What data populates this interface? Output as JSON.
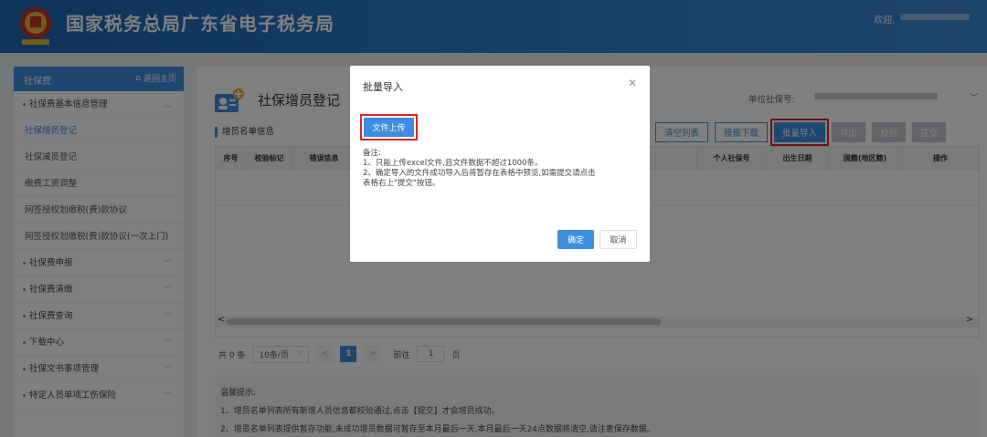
{
  "header": {
    "site_title": "国家税务总局广东省电子税务局",
    "welcome": "欢迎,"
  },
  "sidebar": {
    "title": "社保费",
    "home_link": "返回主页",
    "items": [
      {
        "label": "社保费基本信息管理",
        "type": "group"
      },
      {
        "label": "社保增员登记",
        "type": "sub",
        "active": true
      },
      {
        "label": "社保减员登记",
        "type": "sub"
      },
      {
        "label": "缴费工资调整",
        "type": "sub"
      },
      {
        "label": "网签授权划缴税(费)款协议",
        "type": "sub"
      },
      {
        "label": "网签授权划缴税(费)款协议(一次上门)",
        "type": "sub"
      },
      {
        "label": "社保费申报",
        "type": "group"
      },
      {
        "label": "社保费清缴",
        "type": "group"
      },
      {
        "label": "社保费查询",
        "type": "group"
      },
      {
        "label": "下载中心",
        "type": "group"
      },
      {
        "label": "社保文书事项管理",
        "type": "group"
      },
      {
        "label": "特定人员单项工伤保险",
        "type": "group"
      }
    ]
  },
  "main": {
    "page_title": "社保增员登记",
    "unit_label": "单位社保号:",
    "section_title": "增员名单信息",
    "buttons": {
      "clear": "清空列表",
      "template": "模板下载",
      "batch_import": "批量导入",
      "export": "导出",
      "verify": "校验",
      "submit": "提交"
    },
    "table": {
      "columns": [
        "序号",
        "校验标记",
        "错误信息",
        "个人社保号",
        "出生日期",
        "国籍(地区籍)",
        "操作"
      ]
    },
    "pager": {
      "total": "共 0 条",
      "page_size": "10条/页",
      "current_page": "1",
      "goto_label": "前往",
      "goto_value": "1",
      "page_unit": "页"
    },
    "tips": {
      "title": "温馨提示:",
      "lines": [
        "1、增员名单列表所有新增人员信息都校验通过,点击【提交】才会增员成功。",
        "2、增员名单列表提供暂存功能,未成功增员数据可暂存至本月最后一天,本月最后一天24点数据将清空,请注意保存数据。"
      ]
    }
  },
  "modal": {
    "title": "批量导入",
    "upload_button": "文件上传",
    "note_title": "备注:",
    "note_lines": [
      "1、只能上传excel文件,且文件数据不超过1000条。",
      "2、确定导入的文件成功导入后将暂存在表格中预览,如需提交请点击",
      "表格右上\"提交\"按钮。"
    ],
    "ok": "确定",
    "cancel": "取消"
  },
  "colors": {
    "header": "#2a79c8",
    "accent": "#3d8ee0",
    "highlight": "#e02424",
    "disabled": "#c5c9ce"
  }
}
